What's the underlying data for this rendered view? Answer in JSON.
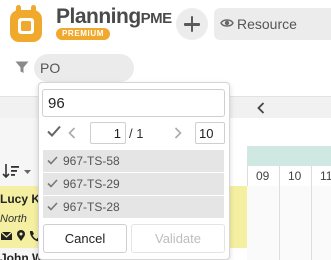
{
  "header": {
    "brand_name_main": "Planning",
    "brand_name_suffix": "PME",
    "brand_badge": "PREMIUM",
    "add_icon": "plus-icon",
    "resource_icon": "eye-icon",
    "resource_label": "Resource"
  },
  "filter": {
    "icon": "funnel-icon",
    "value": "PO"
  },
  "search_popup": {
    "query": "96",
    "current_page": "1",
    "total_pages": "/ 1",
    "page_size": "10",
    "results": [
      {
        "label": "967-TS-58",
        "checked": true
      },
      {
        "label": "967-TS-29",
        "checked": true
      },
      {
        "label": "967-TS-28",
        "checked": true
      }
    ],
    "cancel_label": "Cancel",
    "validate_label": "Validate"
  },
  "planning": {
    "days": [
      "09",
      "10",
      "11"
    ],
    "rows": [
      {
        "name": "Lucy K",
        "subtitle": "North"
      },
      {
        "name": "John Wayne"
      }
    ]
  },
  "colors": {
    "brand_orange": "#f0a92c",
    "row_highlight": "#f5f0a1",
    "calendar_band": "#cfe9e2"
  }
}
